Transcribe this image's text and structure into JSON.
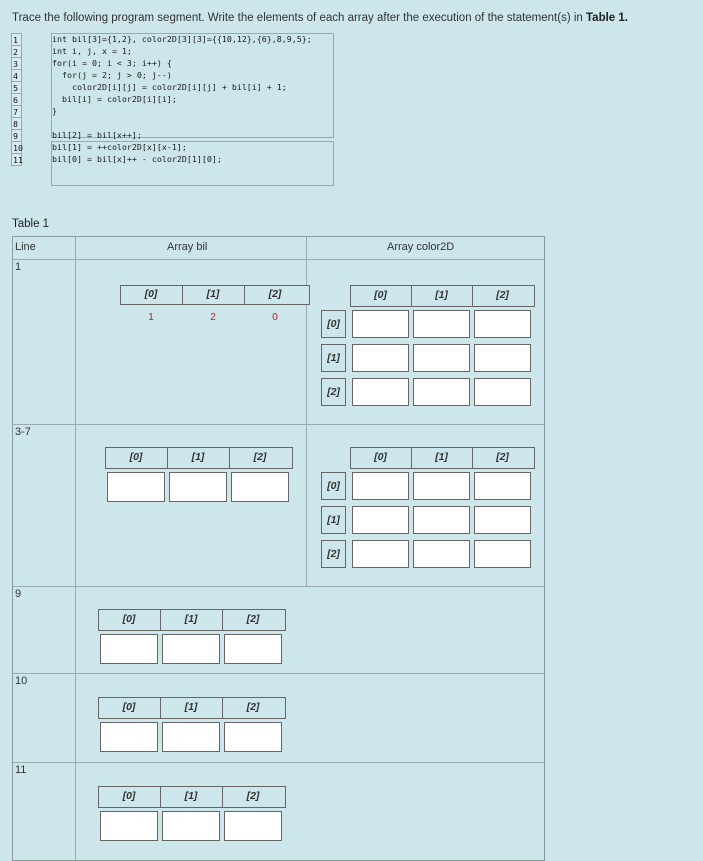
{
  "instruction": {
    "text": "Trace the following program segment. Write the elements of each array after the execution of the statement(s) in ",
    "table_ref": "Table 1."
  },
  "code": {
    "lines": [
      {
        "num": "1",
        "text": "int bil[3]={1,2}, color2D[3][3]={{10,12},{6},8,9,5};"
      },
      {
        "num": "2",
        "text": "int i, j, x = 1;"
      },
      {
        "num": "3",
        "text": "for(i = 0; i < 3; i++) {"
      },
      {
        "num": "4",
        "text": "  for(j = 2; j > 0; j--)"
      },
      {
        "num": "5",
        "text": "    color2D[i][j] = color2D[i][j] + bil[i] + 1;"
      },
      {
        "num": "6",
        "text": "  bil[i] = color2D[i][i];"
      },
      {
        "num": "7",
        "text": "}"
      },
      {
        "num": "8",
        "text": ""
      },
      {
        "num": "9",
        "text": "bil[2] = bil[x++];"
      },
      {
        "num": "10",
        "text": "bil[1] = ++color2D[x][x-1];"
      },
      {
        "num": "11",
        "text": "bil[0] = bil[x]++ - color2D[1][0];"
      }
    ]
  },
  "table": {
    "caption": "Table 1",
    "headers": {
      "line": "Line",
      "bil": "Array bil",
      "color2d": "Array color2D"
    },
    "rows": [
      {
        "line": "1",
        "bil_values": [
          "1",
          "2",
          "0"
        ]
      },
      {
        "line": "3-7"
      },
      {
        "line": "9"
      },
      {
        "line": "10"
      },
      {
        "line": "11"
      }
    ],
    "col_indices": [
      "[0]",
      "[1]",
      "[2]"
    ],
    "row_indices": [
      "[0]",
      "[1]",
      "[2]"
    ]
  },
  "colors": {
    "background": "#cde6eb",
    "value_red": "#dd1111"
  }
}
